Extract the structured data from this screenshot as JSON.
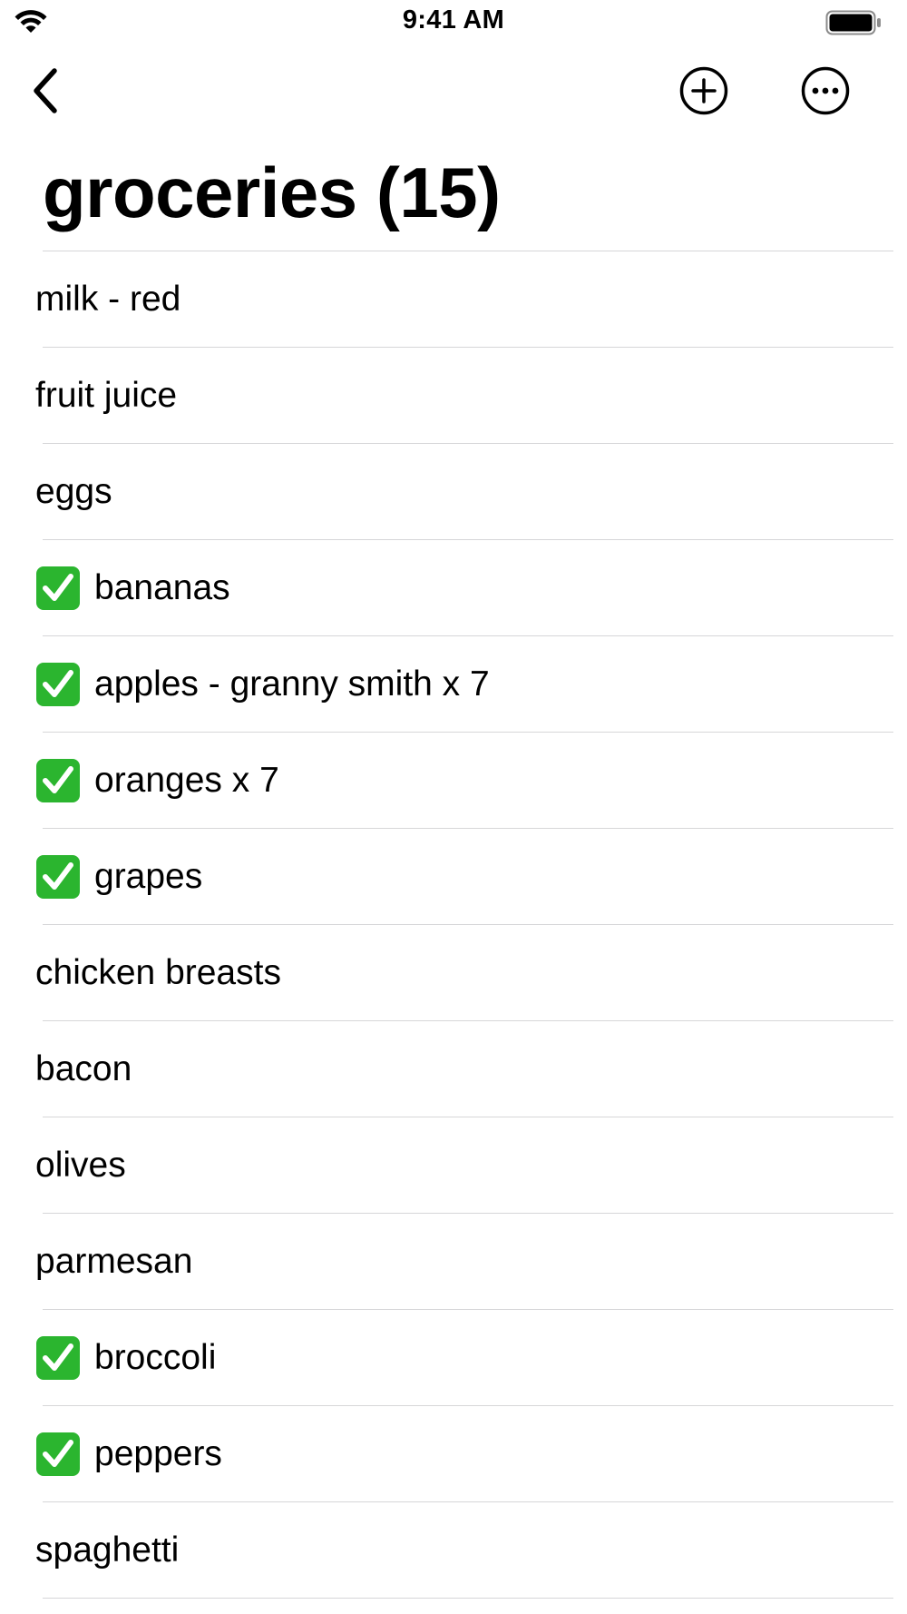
{
  "status_bar": {
    "time": "9:41 AM",
    "icons": [
      "wifi-icon",
      "battery-icon"
    ]
  },
  "nav": {
    "back_icon": "chevron-left-icon",
    "add_icon": "plus-circle-icon",
    "more_icon": "ellipsis-circle-icon"
  },
  "title": "groceries (15)",
  "colors": {
    "check_green": "#2bb52f",
    "divider": "#d6d6d8"
  },
  "items": [
    {
      "label": "milk - red",
      "checked": false
    },
    {
      "label": "fruit juice",
      "checked": false
    },
    {
      "label": "eggs",
      "checked": false
    },
    {
      "label": "bananas",
      "checked": true
    },
    {
      "label": "apples - granny smith x 7",
      "checked": true
    },
    {
      "label": "oranges x 7",
      "checked": true
    },
    {
      "label": "grapes",
      "checked": true
    },
    {
      "label": "chicken breasts",
      "checked": false
    },
    {
      "label": "bacon",
      "checked": false
    },
    {
      "label": "olives",
      "checked": false
    },
    {
      "label": "parmesan",
      "checked": false
    },
    {
      "label": "broccoli",
      "checked": true
    },
    {
      "label": "peppers",
      "checked": true
    },
    {
      "label": "spaghetti",
      "checked": false
    }
  ]
}
